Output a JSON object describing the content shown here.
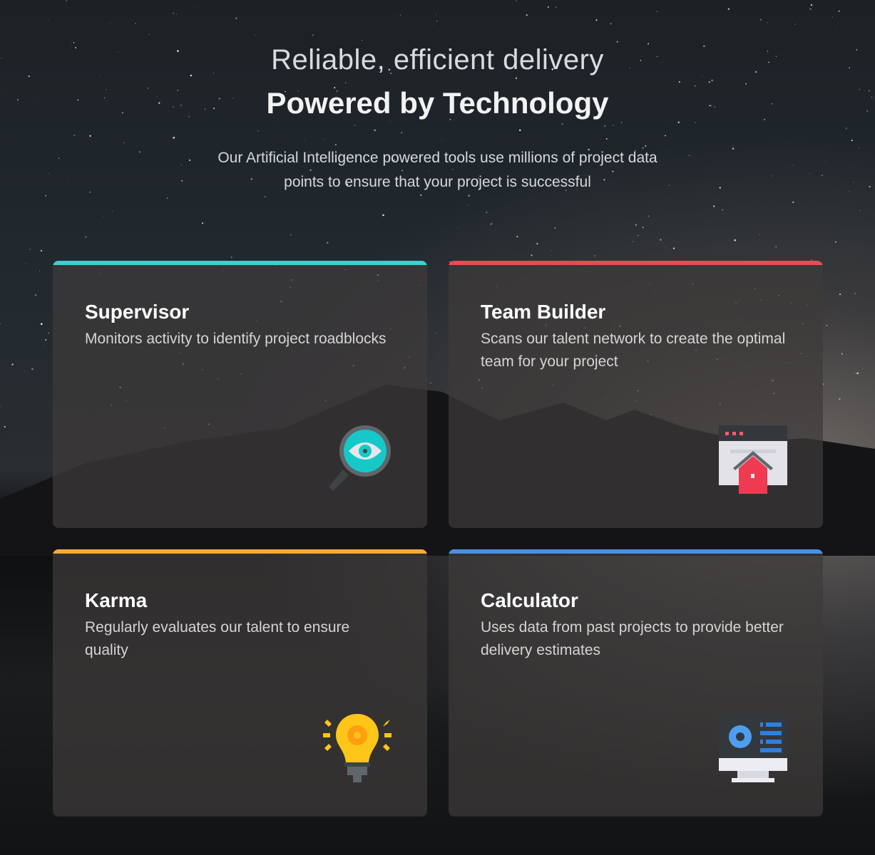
{
  "header": {
    "subtitle": "Reliable, efficient delivery",
    "title": "Powered by Technology",
    "description_line1": "Our Artificial Intelligence powered tools use millions of project data",
    "description_line2": "points to ensure that your project is successful"
  },
  "cards": [
    {
      "title": "Supervisor",
      "description": "Monitors activity to identify project roadblocks",
      "accent": "#3ecfcf",
      "icon": "magnifier-eye-icon"
    },
    {
      "title": "Team Builder",
      "description": "Scans our talent network to create the optimal team for your project",
      "accent": "#e84c4f",
      "icon": "browser-home-icon"
    },
    {
      "title": "Karma",
      "description": "Regularly evaluates our talent to ensure quality",
      "accent": "#f6a93b",
      "icon": "lightbulb-gear-icon"
    },
    {
      "title": "Calculator",
      "description": "Uses data from past projects to provide better delivery estimates",
      "accent": "#4a90e2",
      "icon": "monitor-chart-icon"
    }
  ]
}
